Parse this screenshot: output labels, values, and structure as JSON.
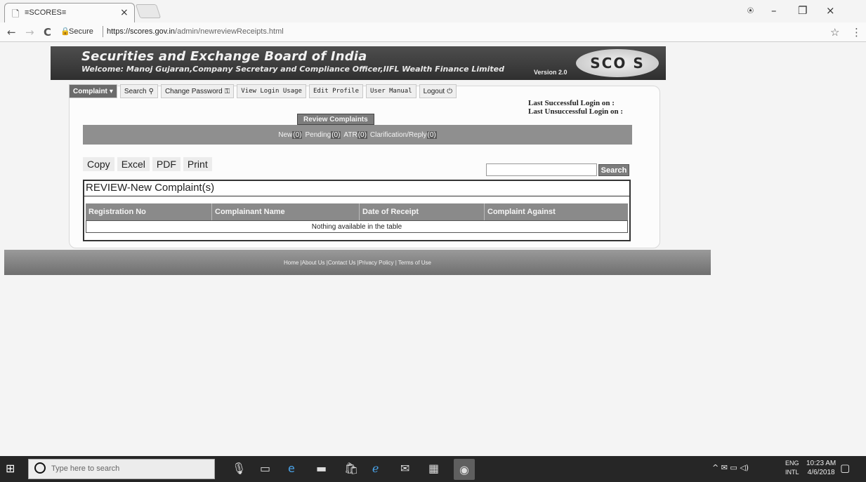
{
  "browser": {
    "tab_icon": "page-icon",
    "tab_title": "≡SCORES≡",
    "tab_close": "×",
    "secure_label": "Secure",
    "url_host": "https://scores.gov.in",
    "url_path": "/admin/newreviewReceipts.html",
    "account_icon": "account-icon",
    "minimize": "–",
    "maximize": "❐",
    "close": "×",
    "back": "←",
    "forward": "→",
    "reload": "C",
    "star": "☆",
    "menu": "⋮"
  },
  "header": {
    "title": "Securities and Exchange Board of India",
    "welcome": "Welcome: Manoj Gujaran,Company Secretary and Compliance Officer,IIFL Wealth Finance Limited",
    "version": "Version 2.0",
    "logo_text": "SCO  S"
  },
  "menu": {
    "items": [
      {
        "label": "Complaint",
        "icon": "▾"
      },
      {
        "label": "Search",
        "icon": "⚲"
      },
      {
        "label": "Change Password",
        "icon": "⚿"
      },
      {
        "label": "View Login Usage",
        "icon": ""
      },
      {
        "label": "Edit Profile",
        "icon": ""
      },
      {
        "label": "User Manual",
        "icon": ""
      },
      {
        "label": "Logout",
        "icon": "⏻"
      }
    ]
  },
  "login_info": {
    "last_success": "Last Successful Login on :",
    "last_unsuccess": "Last Unsuccessful Login on :"
  },
  "section": {
    "title": "Review Complaints",
    "statuses": [
      {
        "label": "New",
        "count": "(0)"
      },
      {
        "label": "Pending",
        "count": "(0)"
      },
      {
        "label": "ATR",
        "count": "(0)"
      },
      {
        "label": "Clarification/Reply",
        "count": "(0)"
      }
    ]
  },
  "export_buttons": [
    "Copy",
    "Excel",
    "PDF",
    "Print"
  ],
  "search": {
    "value": "",
    "button": "Search"
  },
  "table": {
    "caption": "REVIEW-New Complaint(s)",
    "columns": [
      "Registration No",
      "Complainant Name",
      "Date of Receipt",
      "Complaint Against"
    ],
    "empty_message": "Nothing available in the table"
  },
  "footer": {
    "links": "Home |About Us |Contact Us |Privacy Policy | Terms of Use"
  },
  "taskbar": {
    "start": "⊞",
    "search_placeholder": "Type here to search",
    "tray_icons": "^ ✉ ▭ ◁)",
    "lang_top": "ENG",
    "lang_bottom": "INTL",
    "time": "10:23 AM",
    "date": "4/6/2018",
    "notification": "▢"
  }
}
